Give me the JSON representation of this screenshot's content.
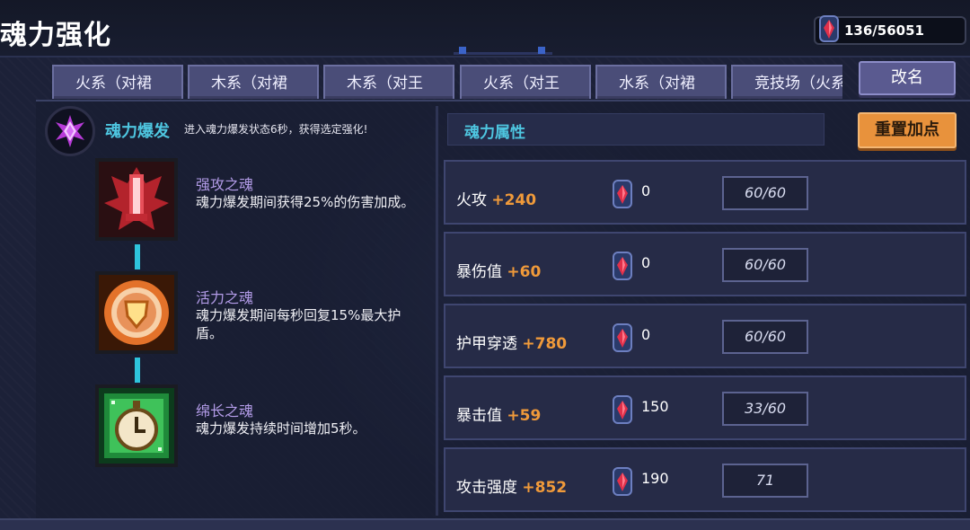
{
  "header": {
    "title": "魂力强化",
    "currency": {
      "icon": "soul-gem-icon",
      "value": "136/56051"
    }
  },
  "tabs": [
    {
      "label": "火系（对裙"
    },
    {
      "label": "木系（对裙"
    },
    {
      "label": "木系（对王"
    },
    {
      "label": "火系（对王"
    },
    {
      "label": "水系（对裙"
    },
    {
      "label": "竞技场（火系"
    }
  ],
  "rename_label": "改名",
  "burst": {
    "icon": "soul-burst-icon",
    "title": "魂力爆发",
    "description": "进入魂力爆发状态6秒，获得选定强化!"
  },
  "skills": [
    {
      "icon": "attack-soul-icon",
      "name": "强攻之魂",
      "description": "魂力爆发期间获得25%的伤害加成。"
    },
    {
      "icon": "vitality-soul-icon",
      "name": "活力之魂",
      "description": "魂力爆发期间每秒回复15%最大护盾。"
    },
    {
      "icon": "duration-soul-icon",
      "name": "绵长之魂",
      "description": "魂力爆发持续时间增加5秒。"
    }
  ],
  "attributes": {
    "title": "魂力属性",
    "reset_label": "重置加点",
    "rows": [
      {
        "name": "火攻",
        "bonus": "+240",
        "cost": "0",
        "value": "60/60"
      },
      {
        "name": "暴伤值",
        "bonus": "+60",
        "cost": "0",
        "value": "60/60"
      },
      {
        "name": "护甲穿透",
        "bonus": "+780",
        "cost": "0",
        "value": "60/60"
      },
      {
        "name": "暴击值",
        "bonus": "+59",
        "cost": "150",
        "value": "33/60"
      },
      {
        "name": "攻击强度",
        "bonus": "+852",
        "cost": "190",
        "value": "71"
      }
    ]
  },
  "colors": {
    "accent_cyan": "#4ec6e0",
    "bonus_orange": "#f09a3a",
    "skill_name_purple": "#b39ce8",
    "reset_orange": "#e8923c"
  }
}
